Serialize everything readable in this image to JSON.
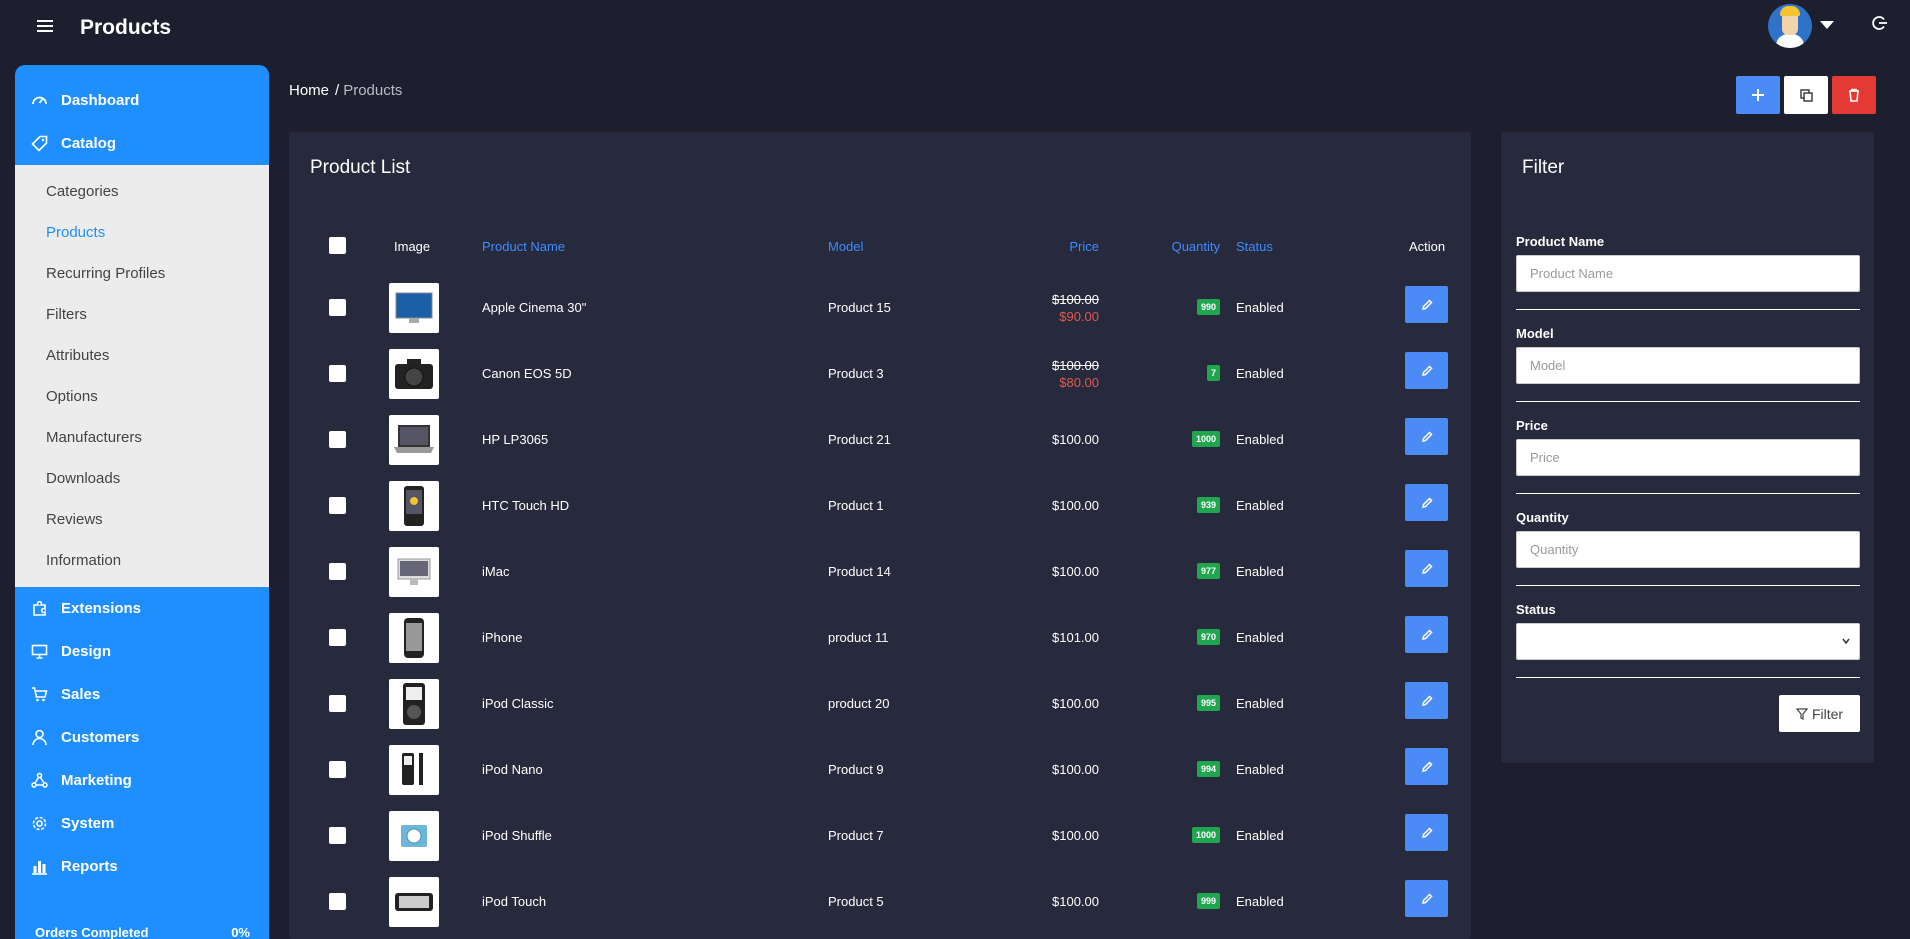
{
  "app": {
    "title": "Products"
  },
  "sidebar": {
    "items_top": [
      {
        "label": "Dashboard",
        "icon": "dashboard-icon"
      },
      {
        "label": "Catalog",
        "icon": "tag-icon"
      }
    ],
    "catalog_sub": [
      {
        "label": "Categories"
      },
      {
        "label": "Products",
        "active": true
      },
      {
        "label": "Recurring Profiles"
      },
      {
        "label": "Filters"
      },
      {
        "label": "Attributes"
      },
      {
        "label": "Options"
      },
      {
        "label": "Manufacturers"
      },
      {
        "label": "Downloads"
      },
      {
        "label": "Reviews"
      },
      {
        "label": "Information"
      }
    ],
    "items_bottom": [
      {
        "label": "Extensions",
        "icon": "puzzle-icon"
      },
      {
        "label": "Design",
        "icon": "monitor-icon"
      },
      {
        "label": "Sales",
        "icon": "cart-icon"
      },
      {
        "label": "Customers",
        "icon": "user-icon"
      },
      {
        "label": "Marketing",
        "icon": "share-icon"
      },
      {
        "label": "System",
        "icon": "cog-icon"
      },
      {
        "label": "Reports",
        "icon": "bar-chart-icon"
      }
    ],
    "orders_label": "Orders Completed",
    "orders_value": "0%"
  },
  "breadcrumb": {
    "home": "Home",
    "separator": "/",
    "current": "Products"
  },
  "product_list": {
    "title": "Product List",
    "columns": {
      "image": "Image",
      "name": "Product Name",
      "model": "Model",
      "price": "Price",
      "quantity": "Quantity",
      "status": "Status",
      "action": "Action"
    },
    "rows": [
      {
        "name": "Apple Cinema 30\"",
        "model": "Product 15",
        "price_old": "$100.00",
        "price": "$90.00",
        "qty": "990",
        "status": "Enabled",
        "image_icon": "monitor-image"
      },
      {
        "name": "Canon EOS 5D",
        "model": "Product 3",
        "price_old": "$100.00",
        "price": "$80.00",
        "qty": "7",
        "status": "Enabled",
        "image_icon": "camera-image"
      },
      {
        "name": "HP LP3065",
        "model": "Product 21",
        "price": "$100.00",
        "qty": "1000",
        "status": "Enabled",
        "image_icon": "laptop-image"
      },
      {
        "name": "HTC Touch HD",
        "model": "Product 1",
        "price": "$100.00",
        "qty": "939",
        "status": "Enabled",
        "image_icon": "phone-image"
      },
      {
        "name": "iMac",
        "model": "Product 14",
        "price": "$100.00",
        "qty": "977",
        "status": "Enabled",
        "image_icon": "imac-image"
      },
      {
        "name": "iPhone",
        "model": "product 11",
        "price": "$101.00",
        "qty": "970",
        "status": "Enabled",
        "image_icon": "iphone-image"
      },
      {
        "name": "iPod Classic",
        "model": "product 20",
        "price": "$100.00",
        "qty": "995",
        "status": "Enabled",
        "image_icon": "ipod-classic-image"
      },
      {
        "name": "iPod Nano",
        "model": "Product 9",
        "price": "$100.00",
        "qty": "994",
        "status": "Enabled",
        "image_icon": "ipod-nano-image"
      },
      {
        "name": "iPod Shuffle",
        "model": "Product 7",
        "price": "$100.00",
        "qty": "1000",
        "status": "Enabled",
        "image_icon": "ipod-shuffle-image"
      },
      {
        "name": "iPod Touch",
        "model": "Product 5",
        "price": "$100.00",
        "qty": "999",
        "status": "Enabled",
        "image_icon": "ipod-touch-image"
      }
    ]
  },
  "filter": {
    "title": "Filter",
    "fields": [
      {
        "label": "Product Name",
        "placeholder": "Product Name"
      },
      {
        "label": "Model",
        "placeholder": "Model"
      },
      {
        "label": "Price",
        "placeholder": "Price"
      },
      {
        "label": "Quantity",
        "placeholder": "Quantity"
      }
    ],
    "status_label": "Status",
    "status_value": "",
    "button_label": "Filter"
  },
  "colors": {
    "sidebar_bg": "#1f8fff",
    "background": "#1e1f2e",
    "panel_bg": "#272a3c",
    "add_button": "#4b8bf5",
    "delete_button": "#e53935",
    "qty_badge": "#21a650",
    "special_price": "#e05a4f"
  }
}
